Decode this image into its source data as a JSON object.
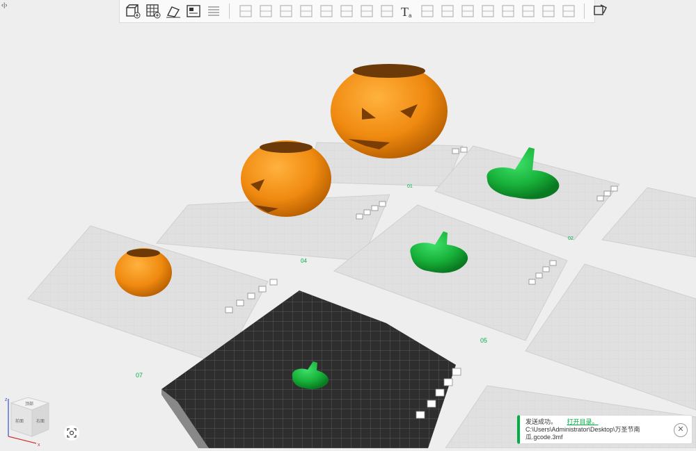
{
  "toolbar": {
    "tools": [
      "add-part-icon",
      "add-plate-icon",
      "auto-orient-icon",
      "arrange-icon",
      "split-objects-icon",
      "move-icon",
      "rotate-icon",
      "scale-icon",
      "place-on-face-icon",
      "cut-icon",
      "boolean-icon",
      "support-paint-icon",
      "seam-paint-icon",
      "text-icon",
      "emboss-icon",
      "measure-icon",
      "assembly-icon",
      "layers-icon",
      "variable-height-icon",
      "slice-plate-icon",
      "print-plate-icon",
      "ruler-icon",
      "explode-icon"
    ]
  },
  "plates": [
    {
      "id": "plate-01",
      "label": "01",
      "object": "pumpkin-large"
    },
    {
      "id": "plate-02",
      "label": "02",
      "object": "witch-hat-large"
    },
    {
      "id": "plate-04",
      "label": "04",
      "object": "pumpkin-medium"
    },
    {
      "id": "plate-05",
      "label": "05",
      "object": "witch-hat-medium"
    },
    {
      "id": "plate-07",
      "label": "07",
      "object": "pumpkin-small"
    },
    {
      "id": "plate-active",
      "label": "",
      "object": "witch-hat-small"
    }
  ],
  "colors": {
    "pumpkin": "#f08a10",
    "witch_hat": "#18b23a",
    "accent": "#00ae42",
    "active_plate": "#3d3d3d"
  },
  "view_cube": {
    "top": "顶部",
    "front": "前面",
    "right": "右面",
    "axis_x": "x",
    "axis_z": "z"
  },
  "toast": {
    "message": "发送成功。",
    "link": "打开目录。",
    "path": "C:\\Users\\Administrator\\Desktop\\万圣节南瓜.gcode.3mf"
  }
}
